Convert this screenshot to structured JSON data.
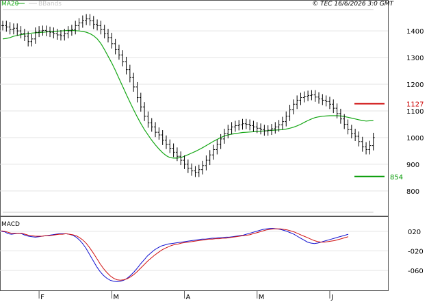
{
  "header": {
    "legend_ma_label": "MA20",
    "legend_bb_label": "BBands",
    "copyright": "© TEC 16/6/2026 3:0 GMT"
  },
  "colors": {
    "price": "#000000",
    "ma": "#13a613",
    "bbands": "#c8c8c8",
    "macd": "#1010d0",
    "signal": "#d01010",
    "resistance": "#cc0000",
    "support": "#009900",
    "grid": "#e3e3e3",
    "divider": "#555555"
  },
  "chart_data": [
    {
      "type": "ohlc",
      "title": "",
      "y_ticks": [
        800,
        900,
        1000,
        1100,
        1200,
        1300,
        1400
      ],
      "ylim": [
        720,
        1480
      ],
      "x_month_labels": [
        "F",
        "M",
        "A",
        "M",
        "J"
      ],
      "x_month_index": [
        10,
        30,
        50,
        70,
        90
      ],
      "n_bars": 103,
      "close": [
        1420,
        1415,
        1405,
        1410,
        1400,
        1390,
        1380,
        1360,
        1370,
        1395,
        1400,
        1402,
        1398,
        1395,
        1390,
        1385,
        1382,
        1390,
        1400,
        1405,
        1420,
        1430,
        1440,
        1445,
        1438,
        1425,
        1420,
        1405,
        1390,
        1375,
        1352,
        1330,
        1310,
        1285,
        1255,
        1225,
        1190,
        1150,
        1115,
        1080,
        1055,
        1040,
        1020,
        1010,
        990,
        975,
        960,
        945,
        930,
        915,
        900,
        885,
        875,
        870,
        880,
        895,
        915,
        935,
        955,
        975,
        995,
        1015,
        1030,
        1040,
        1045,
        1048,
        1052,
        1050,
        1045,
        1040,
        1035,
        1030,
        1025,
        1028,
        1033,
        1040,
        1048,
        1060,
        1080,
        1105,
        1125,
        1140,
        1150,
        1155,
        1158,
        1160,
        1152,
        1145,
        1140,
        1135,
        1125,
        1110,
        1090,
        1070,
        1050,
        1030,
        1015,
        1005,
        985,
        965,
        955,
        970,
        1000
      ],
      "ma20": [
        1370,
        1372,
        1375,
        1380,
        1383,
        1386,
        1388,
        1390,
        1392,
        1393,
        1394,
        1395,
        1396,
        1397,
        1398,
        1399,
        1400,
        1401,
        1402,
        1402,
        1401,
        1400,
        1398,
        1395,
        1390,
        1382,
        1370,
        1353,
        1330,
        1305,
        1280,
        1252,
        1222,
        1192,
        1162,
        1133,
        1105,
        1078,
        1053,
        1030,
        1010,
        990,
        973,
        957,
        943,
        932,
        925,
        923,
        923,
        925,
        930,
        936,
        942,
        948,
        955,
        962,
        970,
        978,
        986,
        993,
        1000,
        1006,
        1010,
        1013,
        1015,
        1017,
        1019,
        1020,
        1021,
        1022,
        1023,
        1024,
        1025,
        1026,
        1027,
        1028,
        1029,
        1030,
        1032,
        1035,
        1039,
        1044,
        1050,
        1057,
        1064,
        1070,
        1075,
        1078,
        1080,
        1081,
        1082,
        1082,
        1082,
        1081,
        1079,
        1076,
        1073,
        1070,
        1067,
        1064,
        1062,
        1063,
        1064
      ],
      "bb_upper": [
        1480,
        1480,
        1480,
        1480,
        1480,
        1480,
        1480,
        1480,
        1480,
        1480,
        1480,
        1480,
        1480,
        1480,
        1480,
        1480,
        1480,
        1480,
        1480,
        1480,
        1480,
        1480,
        1480,
        1480,
        1480,
        1480,
        1480,
        1480,
        1480,
        1480,
        1480,
        1480,
        1480,
        1480,
        1480,
        1480,
        1480,
        1480,
        1480,
        1480,
        1480,
        1480,
        1480,
        1480,
        1480,
        1480,
        1480,
        1480,
        1480,
        1480,
        1480,
        1480,
        1480,
        1480,
        1480,
        1480,
        1480,
        1480,
        1480,
        1480,
        1480,
        1480,
        1480,
        1480,
        1480,
        1480,
        1480,
        1480,
        1480,
        1480,
        1480,
        1480,
        1480,
        1480,
        1480,
        1480,
        1480,
        1480,
        1480,
        1480,
        1480,
        1480,
        1480,
        1480,
        1480,
        1480,
        1480,
        1480,
        1480,
        1480,
        1480,
        1480,
        1480,
        1480,
        1480,
        1480,
        1480,
        1480,
        1480,
        1480,
        1480,
        1480,
        1480
      ],
      "bb_lower": [
        720,
        720,
        720,
        720,
        720,
        720,
        720,
        720,
        720,
        720,
        720,
        720,
        720,
        720,
        720,
        720,
        720,
        720,
        720,
        720,
        720,
        720,
        720,
        720,
        720,
        720,
        720,
        720,
        720,
        720,
        720,
        720,
        720,
        720,
        720,
        720,
        720,
        720,
        720,
        720,
        720,
        720,
        720,
        720,
        720,
        720,
        720,
        720,
        720,
        720,
        720,
        720,
        720,
        720,
        720,
        720,
        720,
        720,
        720,
        720,
        720,
        720,
        720,
        720,
        720,
        720,
        720,
        720,
        720,
        720,
        720,
        720,
        720,
        720,
        720,
        720,
        720,
        720,
        720,
        720,
        720,
        720,
        720,
        720,
        720,
        720,
        720,
        720,
        720,
        720,
        720,
        720,
        720,
        720,
        720,
        720,
        720,
        720,
        720,
        720,
        720,
        720,
        720
      ],
      "resistance_label": "1127",
      "support_label": "854"
    },
    {
      "type": "line",
      "title": "MACD",
      "y_ticks": [
        20,
        -20,
        -60
      ],
      "y_tick_labels": [
        "020",
        "-020",
        "-060"
      ],
      "ylim": [
        -95,
        45
      ],
      "series": [
        {
          "values": [
            20,
            19,
            15,
            14,
            15,
            16,
            15,
            12,
            10,
            9,
            8,
            9,
            10,
            11,
            12,
            13,
            14,
            15,
            15,
            15,
            14,
            12,
            8,
            2,
            -6,
            -16,
            -28,
            -40,
            -52,
            -62,
            -70,
            -76,
            -80,
            -82,
            -83,
            -82,
            -80,
            -76,
            -70,
            -63,
            -55,
            -46,
            -38,
            -30,
            -24,
            -18,
            -14,
            -10,
            -8,
            -6,
            -5,
            -4,
            -3,
            -2,
            -1,
            0,
            1,
            2,
            3,
            4,
            4,
            5,
            6,
            6,
            7,
            7,
            8,
            8,
            9,
            10,
            11,
            12,
            14,
            16,
            18,
            20,
            22,
            24,
            25,
            26,
            26,
            25,
            24,
            22,
            20,
            17,
            14,
            10,
            6,
            2,
            -2,
            -4,
            -5,
            -4,
            -2,
            0,
            2,
            4,
            6,
            8,
            10,
            12,
            14
          ]
        },
        {
          "values": [
            21,
            20,
            18,
            16,
            16,
            16,
            16,
            14,
            12,
            11,
            10,
            10,
            10,
            11,
            11,
            12,
            13,
            14,
            14,
            15,
            14,
            13,
            11,
            7,
            2,
            -5,
            -14,
            -24,
            -35,
            -46,
            -56,
            -64,
            -71,
            -76,
            -79,
            -80,
            -79,
            -77,
            -73,
            -68,
            -62,
            -55,
            -48,
            -41,
            -35,
            -29,
            -24,
            -19,
            -15,
            -12,
            -9,
            -7,
            -6,
            -4,
            -3,
            -2,
            -1,
            0,
            1,
            2,
            3,
            4,
            4,
            5,
            5,
            6,
            6,
            7,
            8,
            9,
            10,
            11,
            12,
            13,
            15,
            17,
            19,
            21,
            23,
            24,
            25,
            25,
            25,
            24,
            23,
            21,
            19,
            16,
            13,
            10,
            7,
            4,
            1,
            -1,
            -2,
            -2,
            -1,
            0,
            1,
            3,
            5,
            7,
            9
          ]
        }
      ]
    }
  ]
}
